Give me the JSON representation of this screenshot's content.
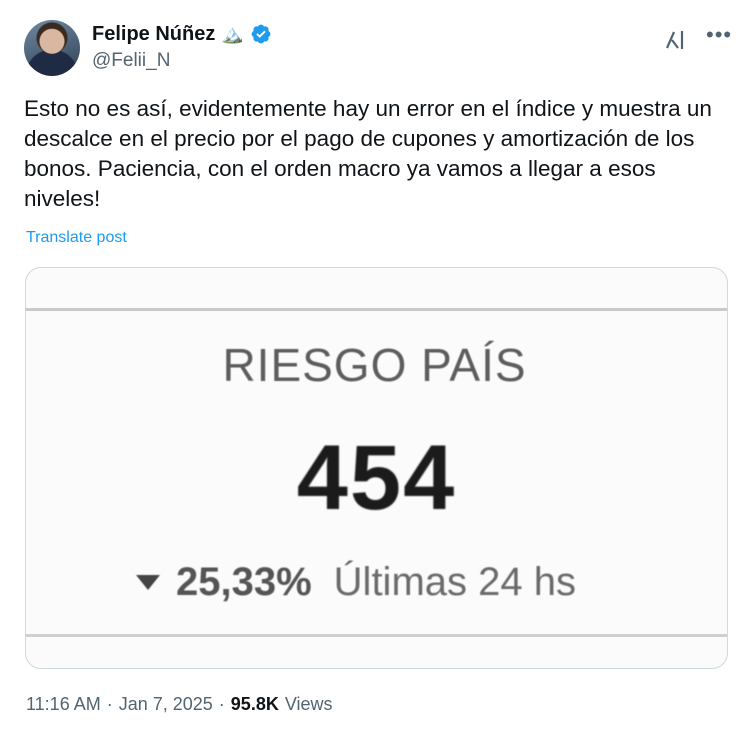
{
  "author": {
    "display_name": "Felipe Núñez",
    "emoji": "🏔️",
    "handle": "@Felii_N",
    "verified": true
  },
  "icons": {
    "verified": "verified-badge-icon",
    "grok": "grok-icon",
    "more": "more-options-icon",
    "emoji": "mountain-emoji-icon"
  },
  "colors": {
    "link": "#1d9bf0",
    "verified": "#1d9bf0",
    "secondary_text": "#536471"
  },
  "post": {
    "text": "Esto no es así, evidentemente hay un error en el índice y muestra un descalce en el precio por el pago de cupones y amortización de los bonos. Paciencia, con el orden macro ya vamos a llegar a esos niveles!",
    "translate_label": "Translate post"
  },
  "media": {
    "title": "RIESGO PAÍS",
    "value": "454",
    "change": "25,33%",
    "period": "Últimas 24 hs"
  },
  "footer": {
    "time": "11:16 AM",
    "sep1": "·",
    "date": "Jan 7, 2025",
    "sep2": "·",
    "views_count": "95.8K",
    "views_label": "Views"
  }
}
